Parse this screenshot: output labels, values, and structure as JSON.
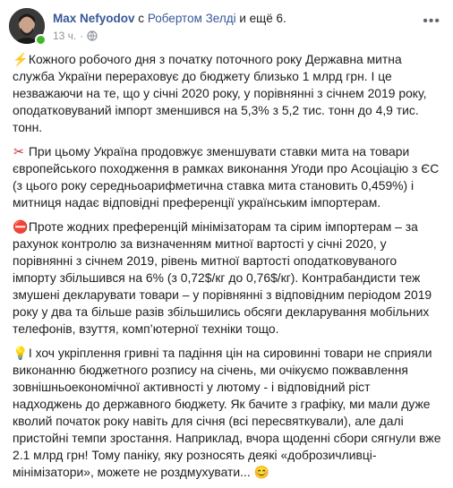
{
  "author": {
    "name": "Max Nefyodov",
    "with_prefix": "с",
    "tagged": "Робертом Зелді",
    "and_more": "и ещё 6."
  },
  "meta": {
    "time": "13 ч."
  },
  "paragraphs": [
    {
      "emoji": "⚡",
      "icon": "lightning-icon",
      "text": "Кожного робочого дня з початку поточного року Державна митна служба України перераховує до бюджету близько 1 млрд грн. І це незважаючи на те, що у січні 2020 року, у порівнянні з січнем 2019 року, оподатковуваний імпорт зменшився на 5,3% з 5,2 тис. тонн до 4,9 тис. тонн."
    },
    {
      "emoji": "✂",
      "icon": "scissors-icon",
      "text": "При цьому Україна продовжує зменшувати ставки мита на товари європейського походження в рамках виконання Угоди про Асоціацію з ЄС (з цього року середньоарифметична ставка мита становить 0,459%) і митниця надає відповідні преференції українським імпортерам."
    },
    {
      "emoji": "⛔",
      "icon": "no-entry-icon",
      "text": "Проте жодних преференцій мінімізаторам та сірим імпортерам – за рахунок контролю за визначенням митної вартості у січні 2020, у порівнянні з січнем 2019, рівень митної вартості оподатковуваного імпорту збільшився на 6% (з 0,72$/кг до 0,76$/кг). Контрабандисти теж змушені декларувати товари – у порівнянні з відповідним періодом 2019 року у два та більше разів збільшились обсяги декларування мобільних телефонів, взуття, комп’ютерної техніки тощо."
    },
    {
      "emoji": "💡",
      "icon": "lightbulb-icon",
      "text": "І хоч укріплення гривні та падіння цін на сировинні товари не сприяли виконанню бюджетного розпису на січень, ми очікуємо пожвавлення зовнішньоекономічної активності у лютому - і відповідний ріст надходжень до державного бюджету. Як бачите з графіку, ми мали дуже кволий початок року навіть для січня (всі пересвяткували), але далі пристойні темпи зростання. Наприклад, вчора щоденні сбори сягнули вже 2.1 млрд грн! Тому паніку, яку розносять деякі «доброзичливці-мінімізатори», можете не роздмухувати...",
      "end_emoji": "😊",
      "end_icon": "smiling-face-icon"
    }
  ]
}
